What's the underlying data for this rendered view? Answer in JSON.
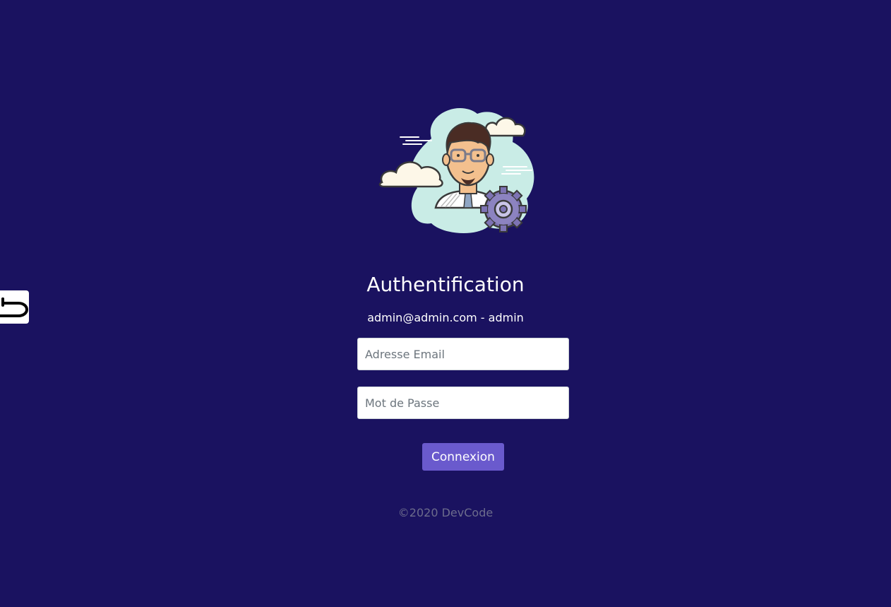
{
  "colors": {
    "background": "#1a1260",
    "button": "#6a5acd",
    "footer_text": "#6c6c8c"
  },
  "back_button": {
    "icon": "return-arrow-icon"
  },
  "avatar": {
    "icon": "user-avatar-illustration"
  },
  "login": {
    "title": "Authentification",
    "credentials_hint": "admin@admin.com - admin",
    "email_placeholder": "Adresse Email",
    "email_value": "",
    "password_placeholder": "Mot de Passe",
    "password_value": "",
    "submit_label": "Connexion"
  },
  "footer": {
    "text": "©2020 DevCode"
  }
}
